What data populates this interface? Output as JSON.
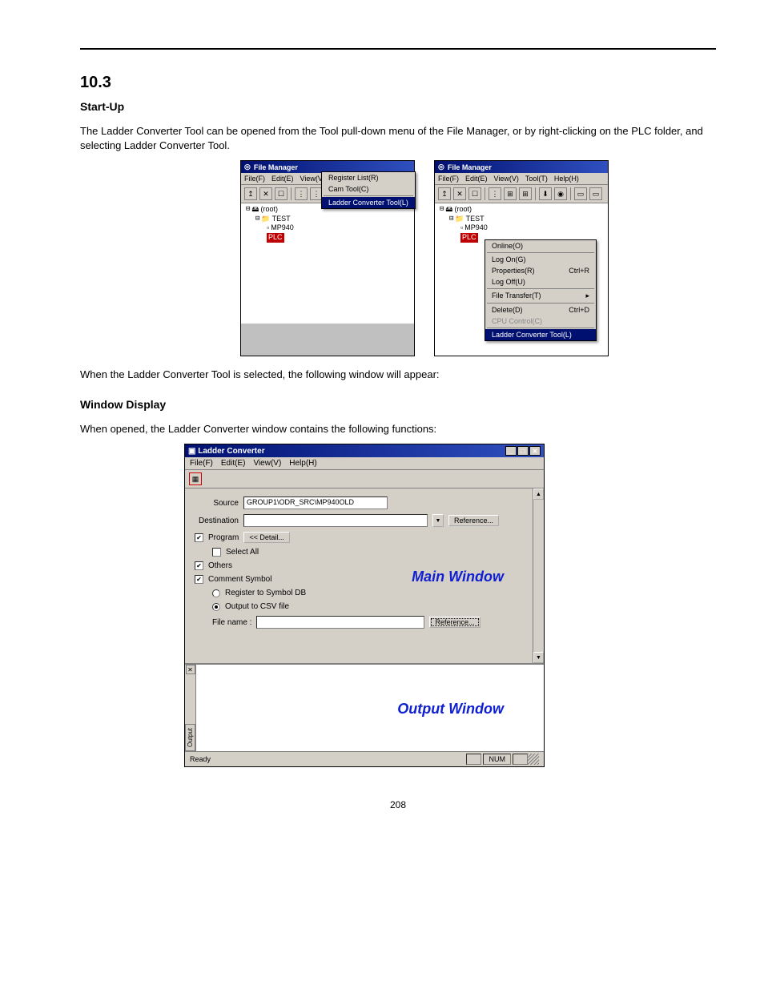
{
  "section_number": "10.3",
  "section_title": "Start-Up",
  "intro_text": "The Ladder Converter Tool can be opened from the Tool pull-down menu of the File Manager, or by right-clicking on the PLC folder, and selecting Ladder Converter Tool.",
  "filemanager": {
    "title": "File Manager",
    "menus": {
      "file": "File(F)",
      "edit": "Edit(E)",
      "view": "View(V)",
      "tool": "Tool(T)",
      "help": "Help(H)"
    },
    "tree": {
      "root": "(root)",
      "test": "TEST",
      "mp940": "MP940",
      "plc": "PLC"
    },
    "tool_dropdown": {
      "register_list": "Register List(R)",
      "cam_tool": "Cam Tool(C)",
      "ladder_converter": "Ladder Converter Tool(L)"
    },
    "context_menu": {
      "online": "Online(O)",
      "logon": "Log On(G)",
      "properties": "Properties(R)",
      "properties_shortcut": "Ctrl+R",
      "logoff": "Log Off(U)",
      "file_transfer": "File Transfer(T)",
      "delete": "Delete(D)",
      "delete_shortcut": "Ctrl+D",
      "cpu_control": "CPU Control(C)",
      "ladder_converter": "Ladder Converter Tool(L)"
    }
  },
  "follow_text": "When the Ladder Converter Tool is selected, the following window will appear:",
  "section_title_2": "Window Display",
  "section_text_2": "When opened, the Ladder Converter window contains the following functions:",
  "ladder_converter": {
    "title": "Ladder Converter",
    "menus": {
      "file": "File(F)",
      "edit": "Edit(E)",
      "view": "View(V)",
      "help": "Help(H)"
    },
    "source_label": "Source",
    "source_value": "GROUP1\\ODR_SRC\\MP940OLD",
    "destination_label": "Destination",
    "destination_value": "",
    "reference_btn": "Reference...",
    "program_chk": "Program",
    "detail_btn": "<< Detail...",
    "select_all_chk": "Select All",
    "others_chk": "Others",
    "comment_symbol_chk": "Comment Symbol",
    "register_radio": "Register to Symbol DB",
    "output_csv_radio": "Output to CSV file",
    "filename_label": "File name :",
    "filename_value": "",
    "reference_btn_2": "Reference...",
    "main_window_label": "Main Window",
    "output_window_label": "Output Window",
    "output_tab": "Output",
    "status_ready": "Ready",
    "status_num": "NUM"
  },
  "page_number": "208"
}
